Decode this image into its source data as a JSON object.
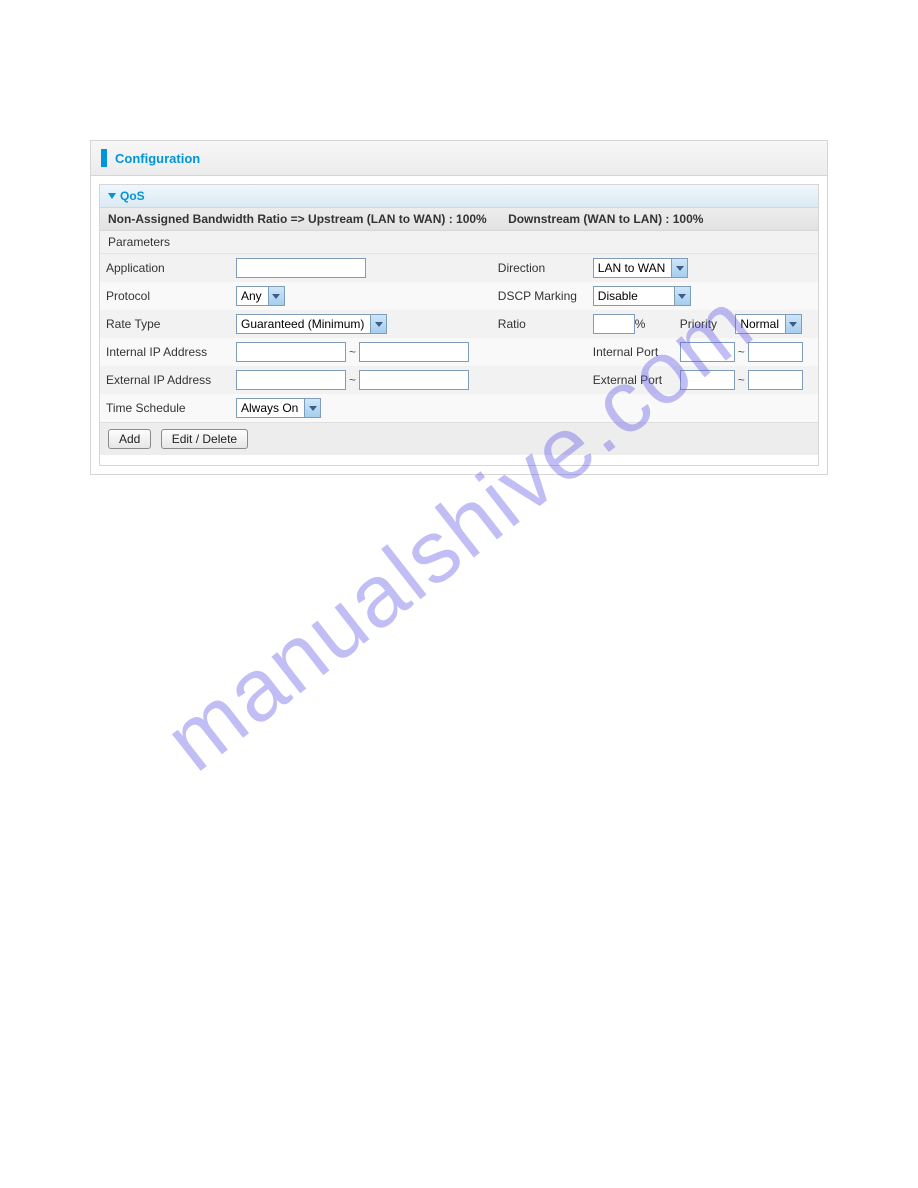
{
  "header": {
    "title": "Configuration"
  },
  "section": {
    "title": "QoS"
  },
  "info": {
    "prefix": "Non-Assigned Bandwidth Ratio =>",
    "upstream": "Upstream (LAN to WAN) : 100%",
    "downstream": "Downstream (WAN to LAN) : 100%"
  },
  "params_label": "Parameters",
  "labels": {
    "application": "Application",
    "direction": "Direction",
    "protocol": "Protocol",
    "dscp": "DSCP Marking",
    "rate_type": "Rate Type",
    "ratio": "Ratio",
    "priority": "Priority",
    "internal_ip": "Internal IP Address",
    "internal_port": "Internal Port",
    "external_ip": "External IP Address",
    "external_port": "External Port",
    "time_schedule": "Time Schedule",
    "percent": "%",
    "tilde": "~"
  },
  "values": {
    "direction": "LAN to WAN",
    "protocol": "Any",
    "dscp": "Disable",
    "rate_type": "Guaranteed (Minimum)",
    "priority": "Normal",
    "time_schedule": "Always On"
  },
  "buttons": {
    "add": "Add",
    "edit_delete": "Edit / Delete"
  },
  "watermark": "manualshive.com"
}
